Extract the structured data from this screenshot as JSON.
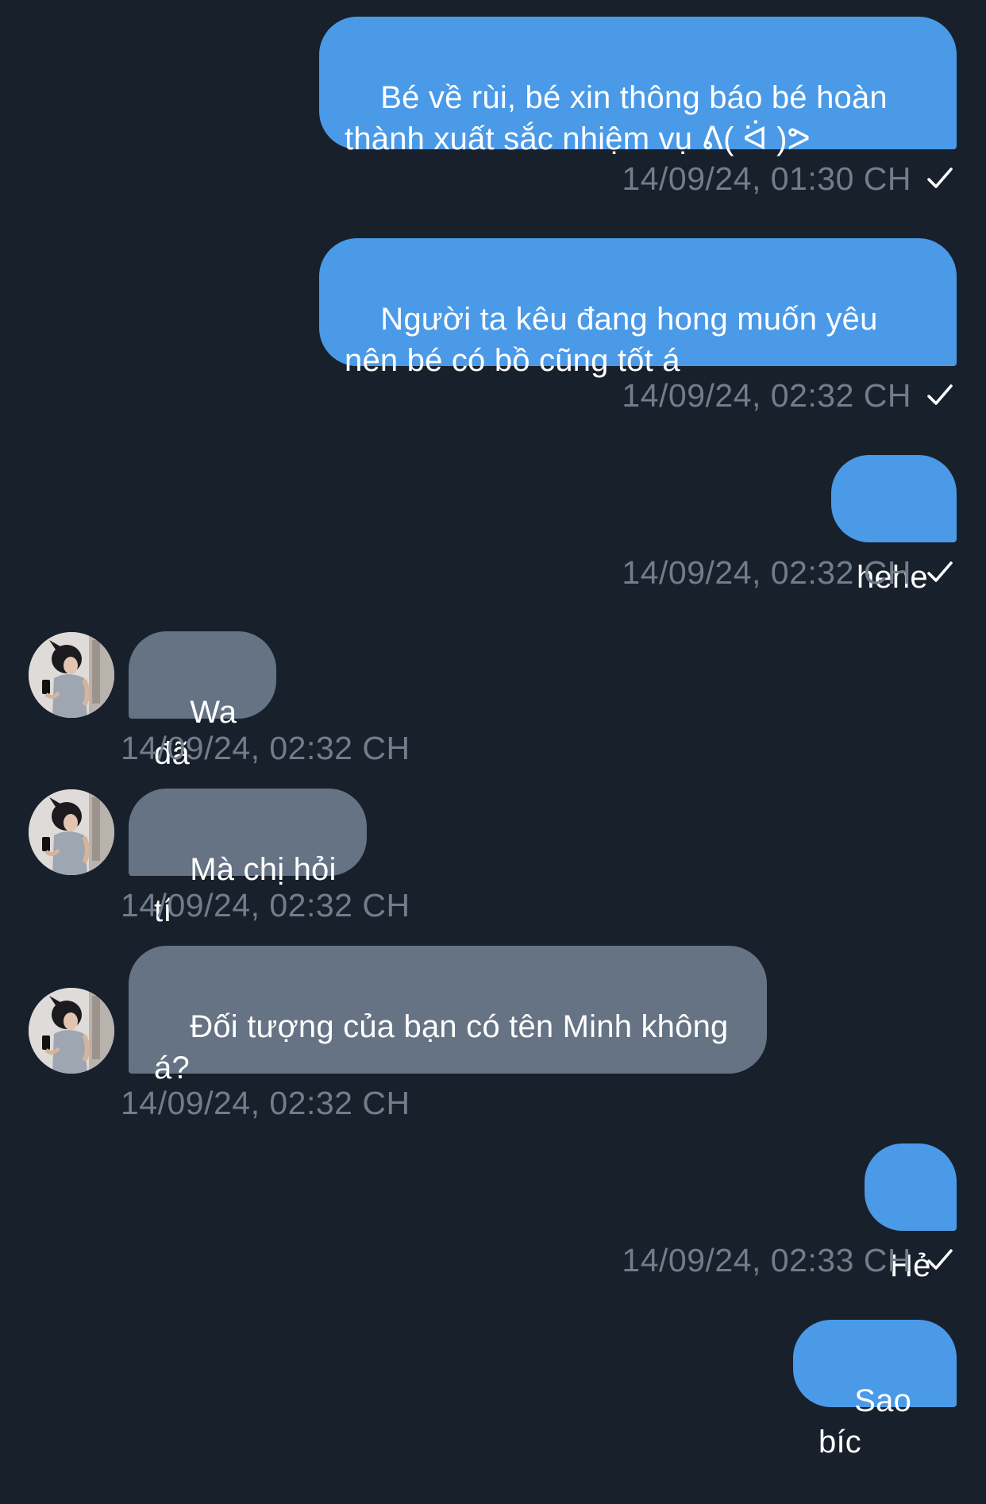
{
  "messages": [
    {
      "direction": "out",
      "text": "Bé về rùi, bé xin thông báo bé hoàn thành xuất sắc nhiệm vụ ᕕ( ᐛ )ᕗ",
      "time": "14/09/24, 01:30 CH"
    },
    {
      "direction": "out",
      "text": "Người ta kêu đang hong muốn yêu nên bé có bồ cũng tốt á",
      "time": "14/09/24, 02:32 CH"
    },
    {
      "direction": "out",
      "text": "hehe",
      "time": "14/09/24, 02:32 CH"
    },
    {
      "direction": "in",
      "text": "Wa đã",
      "time": "14/09/24, 02:32 CH"
    },
    {
      "direction": "in",
      "text": "Mà chị hỏi tí",
      "time": "14/09/24, 02:32 CH"
    },
    {
      "direction": "in",
      "text": "Đối tượng của bạn có tên Minh không á?",
      "time": "14/09/24, 02:32 CH"
    },
    {
      "direction": "out",
      "text": "Hẻ",
      "time": "14/09/24, 02:33 CH"
    },
    {
      "direction": "out",
      "text": "Sao bíc",
      "time": ""
    }
  ],
  "icons": {
    "read_status": "check-icon",
    "contact_avatar": "avatar"
  },
  "colors": {
    "background": "#18202c",
    "outgoing_bubble": "#4a9ae8",
    "incoming_bubble": "#657384",
    "timestamp": "#727c8a",
    "message_text": "#ffffff"
  }
}
